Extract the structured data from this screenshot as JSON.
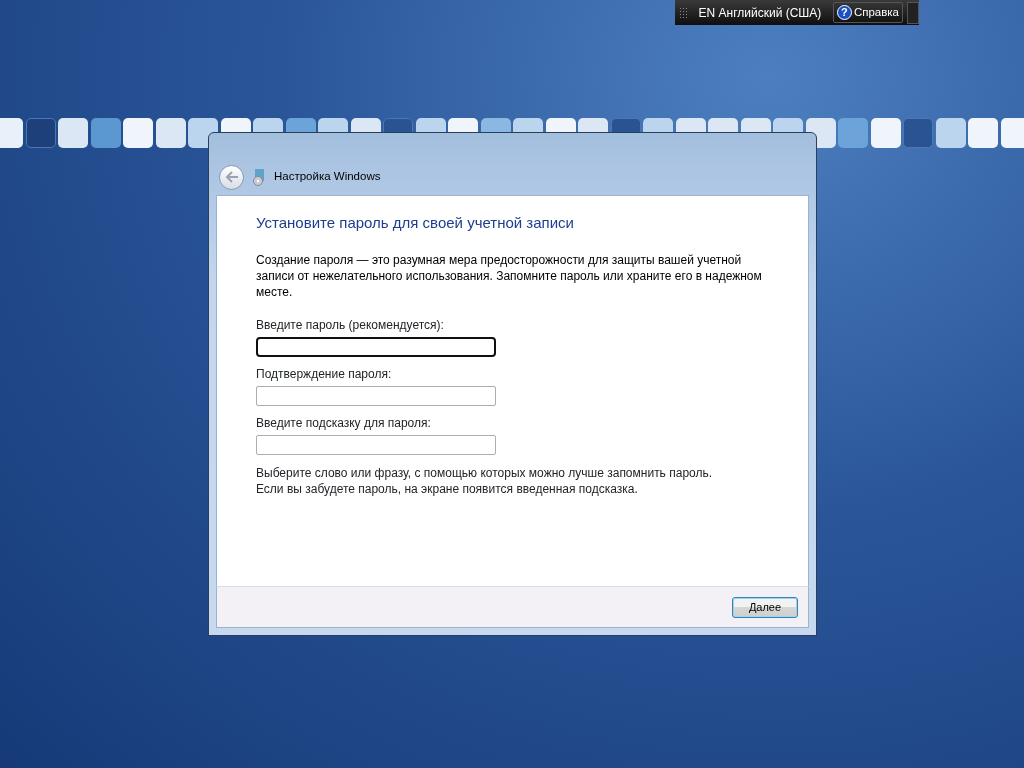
{
  "language_bar": {
    "language": "EN Английский (США)",
    "help_icon": "?",
    "help": "Справка"
  },
  "window": {
    "title": "Настройка Windows"
  },
  "heading": "Установите пароль для своей учетной записи",
  "intro": "Создание пароля — это разумная мера предосторожности для защиты вашей учетной записи от нежелательного использования. Запомните пароль или храните его в надежном месте.",
  "fields": [
    {
      "label": "Введите пароль (рекомендуется):",
      "focused": true
    },
    {
      "label": "Подтверждение пароля:",
      "focused": false
    },
    {
      "label": "Введите подсказку для пароля:",
      "focused": false
    }
  ],
  "hint": [
    "Выберите слово или фразу, с помощью которых можно лучше запомнить пароль.",
    "Если вы забудете пароль, на экране появится введенная подсказка."
  ],
  "buttons": [
    {
      "label": "Далее",
      "default": true
    }
  ]
}
